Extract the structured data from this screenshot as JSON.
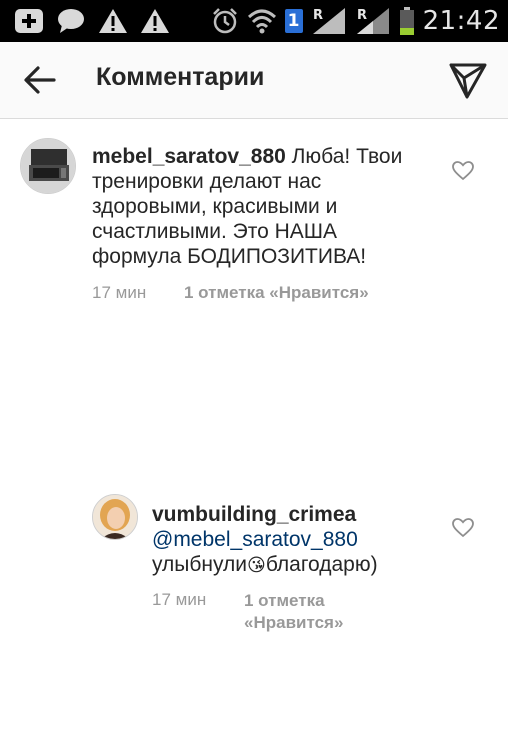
{
  "status_bar": {
    "time": "21:42",
    "sim_badge": "1",
    "left_icons": [
      "add-notification-icon",
      "chat-bubble-icon",
      "warning-icon",
      "warning-icon"
    ],
    "right_icons": [
      "alarm-icon",
      "wifi-icon",
      "signal-roaming-icon",
      "signal-roaming-icon",
      "battery-icon"
    ],
    "roaming_label": "R"
  },
  "header": {
    "title": "Комментарии"
  },
  "comments": [
    {
      "username": "mebel_saratov_880",
      "text_line1": " Люба! Твои",
      "text_line2": "тренировки делают нас",
      "text_line3": "здоровыми, красивыми и",
      "text_line4": "счастливыми. Это НАША",
      "text_line5": "формула БОДИПОЗИТИВА!",
      "time": "17 мин",
      "likes": "1 отметка «Нравится»"
    },
    {
      "username": "vumbuilding_crimea",
      "mention": "@mebel_saratov_880",
      "text_a": "улыбнули",
      "emoji": "😘",
      "text_b": "благодарю)",
      "time": "17 мин",
      "likes_line1": "1 отметка",
      "likes_line2": "«Нравится»"
    }
  ],
  "colors": {
    "status_bar_bg": "#000000",
    "app_bar_bg": "#fafafa",
    "mention": "#003569",
    "meta_text": "#999999",
    "sim_badge": "#2a6fd6"
  }
}
